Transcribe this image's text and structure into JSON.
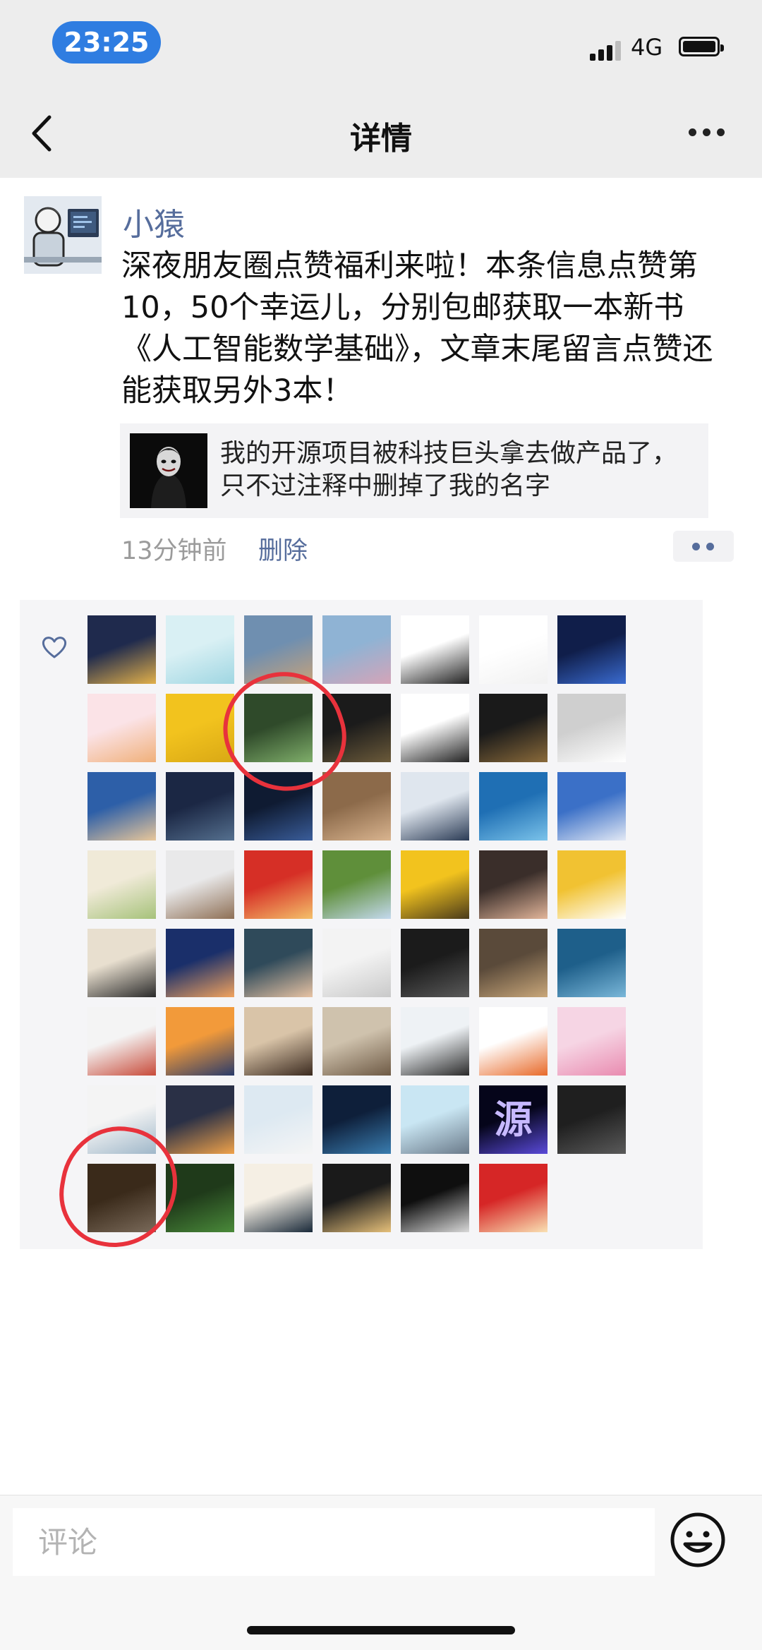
{
  "status_bar": {
    "time": "23:25",
    "network": "4G"
  },
  "nav": {
    "title": "详情",
    "back_icon": "chevron-left-icon",
    "more_icon": "more-horizontal-icon"
  },
  "post": {
    "author": "小猿",
    "content": "深夜朋友圈点赞福利来啦！本条信息点赞第10，50个幸运儿，分别包邮获取一本新书《人工智能数学基础》，文章末尾留言点赞还能获取另外3本！",
    "link_card": {
      "text": "我的开源项目被科技巨头拿去做产品了，只不过注释中删掉了我的名字"
    },
    "time_ago": "13分钟前",
    "delete_label": "删除"
  },
  "likes": {
    "icon": "heart-outline-icon",
    "avatars": [
      {
        "colors": [
          "#1f2a4d",
          "#e2b04a"
        ]
      },
      {
        "colors": [
          "#d9f0f4",
          "#9fd6e2"
        ]
      },
      {
        "colors": [
          "#6f8fb0",
          "#c7a27a"
        ]
      },
      {
        "colors": [
          "#8fb3d4",
          "#d4a4b8"
        ]
      },
      {
        "colors": [
          "#ffffff",
          "#222222"
        ]
      },
      {
        "colors": [
          "#ffffff",
          "#f1f1f1"
        ]
      },
      {
        "colors": [
          "#101e4a",
          "#3a6bd0"
        ]
      },
      {
        "colors": [
          "#fbe3e7",
          "#f0b07a"
        ]
      },
      {
        "colors": [
          "#f2c31e",
          "#d9a815"
        ]
      },
      {
        "colors": [
          "#2f4a2a",
          "#7fae6a"
        ]
      },
      {
        "colors": [
          "#1b1b1b",
          "#6b5a3a"
        ]
      },
      {
        "colors": [
          "#ffffff",
          "#222222"
        ]
      },
      {
        "colors": [
          "#1a1a1a",
          "#8a6a3a"
        ]
      },
      {
        "colors": [
          "#cfcfcf",
          "#ffffff"
        ]
      },
      {
        "colors": [
          "#2d5fa8",
          "#e9c79a"
        ]
      },
      {
        "colors": [
          "#1b2744",
          "#55708f"
        ]
      },
      {
        "colors": [
          "#0f1b32",
          "#3a5d9a"
        ]
      },
      {
        "colors": [
          "#8c6a4a",
          "#d9b48f"
        ]
      },
      {
        "colors": [
          "#dfe6ee",
          "#2b3b55"
        ]
      },
      {
        "colors": [
          "#1f6fb4",
          "#7bc3ea"
        ]
      },
      {
        "colors": [
          "#3b70c7",
          "#e3e9f5"
        ]
      },
      {
        "colors": [
          "#f0ead8",
          "#a6c27a"
        ]
      },
      {
        "colors": [
          "#e9e9ea",
          "#8e6f55"
        ]
      },
      {
        "colors": [
          "#d62f26",
          "#f4c06a"
        ]
      },
      {
        "colors": [
          "#5f8f3a",
          "#c4d9ee"
        ]
      },
      {
        "colors": [
          "#f2c31e",
          "#4a3a1a"
        ]
      },
      {
        "colors": [
          "#3a2e2a",
          "#e2b59a"
        ]
      },
      {
        "colors": [
          "#f1c232",
          "#ffffff"
        ]
      },
      {
        "colors": [
          "#e8dfcf",
          "#2a2a2a"
        ]
      },
      {
        "colors": [
          "#1a2f6a",
          "#f2a35e"
        ]
      },
      {
        "colors": [
          "#2f4a5a",
          "#e8c3a3"
        ]
      },
      {
        "colors": [
          "#f3f3f3",
          "#c9c9c9"
        ]
      },
      {
        "colors": [
          "#1b1b1b",
          "#5a5a5a"
        ]
      },
      {
        "colors": [
          "#5a4a3a",
          "#c9a77a"
        ]
      },
      {
        "colors": [
          "#1e5f8a",
          "#7ab7d9"
        ]
      },
      {
        "colors": [
          "#f4f4f4",
          "#c84b3a"
        ]
      },
      {
        "colors": [
          "#f29a3a",
          "#2a3b6a"
        ]
      },
      {
        "colors": [
          "#d9c4a8",
          "#3b2a1f"
        ]
      },
      {
        "colors": [
          "#cfc2ad",
          "#6e5a45"
        ]
      },
      {
        "colors": [
          "#eef2f5",
          "#2a2a2a"
        ]
      },
      {
        "colors": [
          "#ffffff",
          "#e86a2a"
        ]
      },
      {
        "colors": [
          "#f6d5e4",
          "#e98bb0"
        ]
      },
      {
        "colors": [
          "#f4f4f4",
          "#9fb7c9"
        ]
      },
      {
        "colors": [
          "#2a3046",
          "#f0a24a"
        ]
      },
      {
        "colors": [
          "#dde9f2",
          "#f5f5f5"
        ]
      },
      {
        "colors": [
          "#0e1f3a",
          "#3a7db0"
        ]
      },
      {
        "colors": [
          "#c9e6f3",
          "#6a7a8a"
        ]
      },
      {
        "colors": [
          "#05051a",
          "#5a4ad9"
        ]
      },
      {
        "colors": [
          "#1f1f1f",
          "#5a5a5a"
        ]
      },
      {
        "colors": [
          "#3a2a1a",
          "#7a6a5a"
        ]
      },
      {
        "colors": [
          "#1f3a1a",
          "#4a8a3a"
        ]
      },
      {
        "colors": [
          "#f5efe4",
          "#1a2a3a"
        ]
      },
      {
        "colors": [
          "#1a1a1a",
          "#e6c07a"
        ]
      },
      {
        "colors": [
          "#0f0f0f",
          "#d9d9d9"
        ]
      },
      {
        "colors": [
          "#d62626",
          "#f9e1b3"
        ]
      }
    ],
    "glyph_avatar": {
      "index": 47,
      "glyph": "源",
      "color": "#c7b9ff"
    }
  },
  "comment_bar": {
    "placeholder": "评论",
    "emoji_icon": "smiley-icon"
  },
  "accent": {
    "link_blue": "#566d9c",
    "marker_red": "#e8323c",
    "time_pill": "#2f7de1"
  }
}
